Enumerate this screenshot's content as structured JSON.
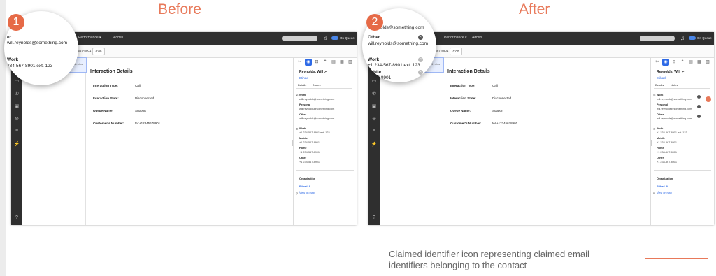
{
  "headings": {
    "before": "Before",
    "after": "After"
  },
  "badges": {
    "one": "1",
    "two": "2"
  },
  "app": {
    "nav_performance": "Performance ▾",
    "nav_admin": "Admin",
    "queue_label": "On Queue",
    "contact_name": "Reynolds, Will",
    "phone": "+1 234-567-8901",
    "timer": "0:00",
    "list_meta": "11 mins"
  },
  "interaction": {
    "title": "Interaction Details",
    "fields": [
      {
        "label": "Interaction Type:",
        "value": "Call"
      },
      {
        "label": "Interaction State:",
        "value": "Disconnected"
      },
      {
        "label": "Queue Name:",
        "value": "Support"
      },
      {
        "label": "Customer's Number:",
        "value": "tel:+12345678901"
      }
    ]
  },
  "contact_panel": {
    "name": "Reynolds, Will ↗",
    "org": "Etihad",
    "tabs": [
      "Details",
      "Notes"
    ],
    "emails": [
      {
        "type": "Work",
        "address": "will.reynolds@something.com"
      },
      {
        "type": "Personal",
        "address": "will.reynolds@something.com"
      },
      {
        "type": "Other",
        "address": "will.reynolds@something.com"
      }
    ],
    "phones": [
      {
        "type": "Work",
        "number": "+1 234-567-8901   ext. 123"
      },
      {
        "type": "Mobile",
        "number": "+1 234-567-8901"
      },
      {
        "type": "Home",
        "number": "+1 234-567-8901"
      },
      {
        "type": "Other",
        "number": "+1 234-567-8901"
      }
    ],
    "organization_label": "Organization",
    "organization_name": "Etihad ↗",
    "view_on_map": "View on map"
  },
  "zoom_before": {
    "label_partial": "er",
    "email": "will.reynolds@something.com",
    "work_label": "Work",
    "work_number": "234-567-8901   ext. 123"
  },
  "zoom_after": {
    "email_top": "l.reynolds@something.com",
    "other_label": "Other",
    "other_email": "will.reynolds@something.com",
    "work_label": "Work",
    "work_number": "+1 234-567-8901   ext. 123",
    "mobile_label": "obile",
    "mobile_number": "4-567-8901"
  },
  "caption": "Claimed identifier icon representing claimed email identifiers belonging to the contact",
  "colors": {
    "accent": "#e8795a",
    "blue": "#2e6ae6",
    "dark": "#2f2f2f"
  }
}
